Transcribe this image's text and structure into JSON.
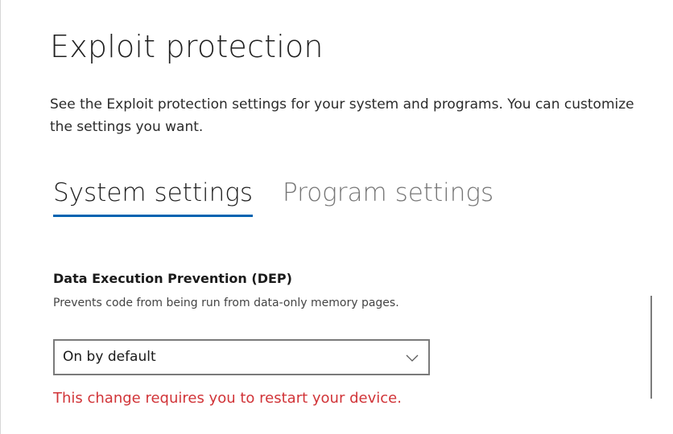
{
  "page": {
    "title": "Exploit protection",
    "description": "See the Exploit protection settings for your system and programs.  You can customize the settings you want."
  },
  "tabs": [
    {
      "label": "System settings",
      "active": true
    },
    {
      "label": "Program settings",
      "active": false
    }
  ],
  "dep_setting": {
    "title": "Data Execution Prevention (DEP)",
    "description": "Prevents code from being run from data-only memory pages.",
    "dropdown_value": "On by default",
    "warning": "This change requires you to restart your device."
  },
  "colors": {
    "accent": "#0063b1",
    "warning": "#d13438"
  },
  "icons": {
    "dropdown": "chevron-down-icon"
  }
}
